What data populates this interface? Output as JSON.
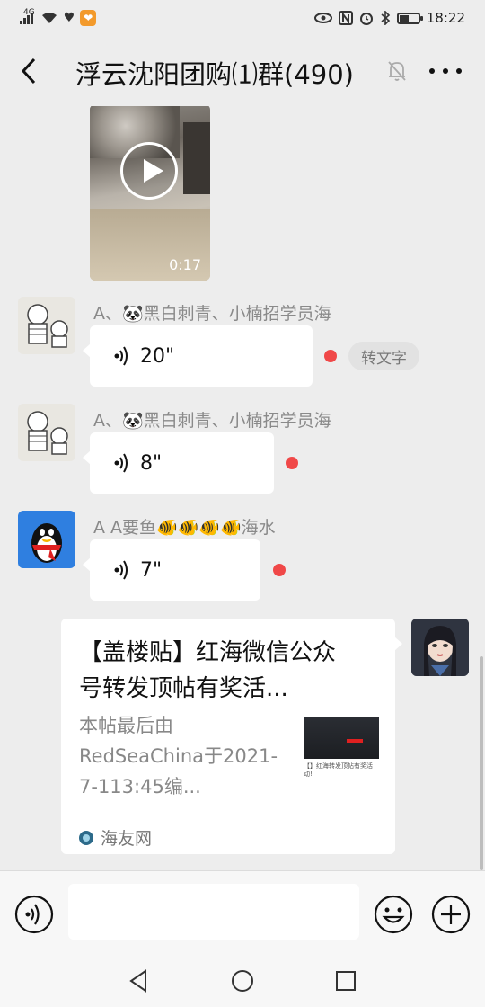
{
  "status_bar": {
    "network": "4G",
    "time": "18:22",
    "battery_level": 0.45
  },
  "header": {
    "title": "浮云沈阳团购⑴群(490)",
    "icons": [
      "back-arrow-icon",
      "mute-bell-icon",
      "more-icon"
    ]
  },
  "messages": {
    "video": {
      "duration": "0:17"
    },
    "voice1": {
      "sender": "A、🐼黑白刺青、小楠招学员海",
      "duration": "20\"",
      "action": "转文字"
    },
    "voice2": {
      "sender": "A、🐼黑白刺青、小楠招学员海",
      "duration": "8\""
    },
    "voice3": {
      "sender": "A  A要鱼🐠🐠🐠🐠海水",
      "duration": "7\""
    },
    "link_card": {
      "title": "【盖楼贴】红海微信公众号转发顶帖有奖活...",
      "desc": "本帖最后由RedSeaChina于2021-7-113:45编...",
      "thumb_caption": "【】红海转发顶帖有奖活动!",
      "source": "海友网"
    }
  },
  "input_bar": {
    "icons": [
      "voice-input-icon",
      "emoji-icon",
      "plus-icon"
    ],
    "text": ""
  },
  "nav_bar": {
    "icons": [
      "back-triangle-icon",
      "home-circle-icon",
      "recents-square-icon"
    ]
  },
  "colors": {
    "background": "#ededed",
    "bubble": "#ffffff",
    "unread_dot": "#f04848",
    "sender_text": "#8a8a8a"
  }
}
